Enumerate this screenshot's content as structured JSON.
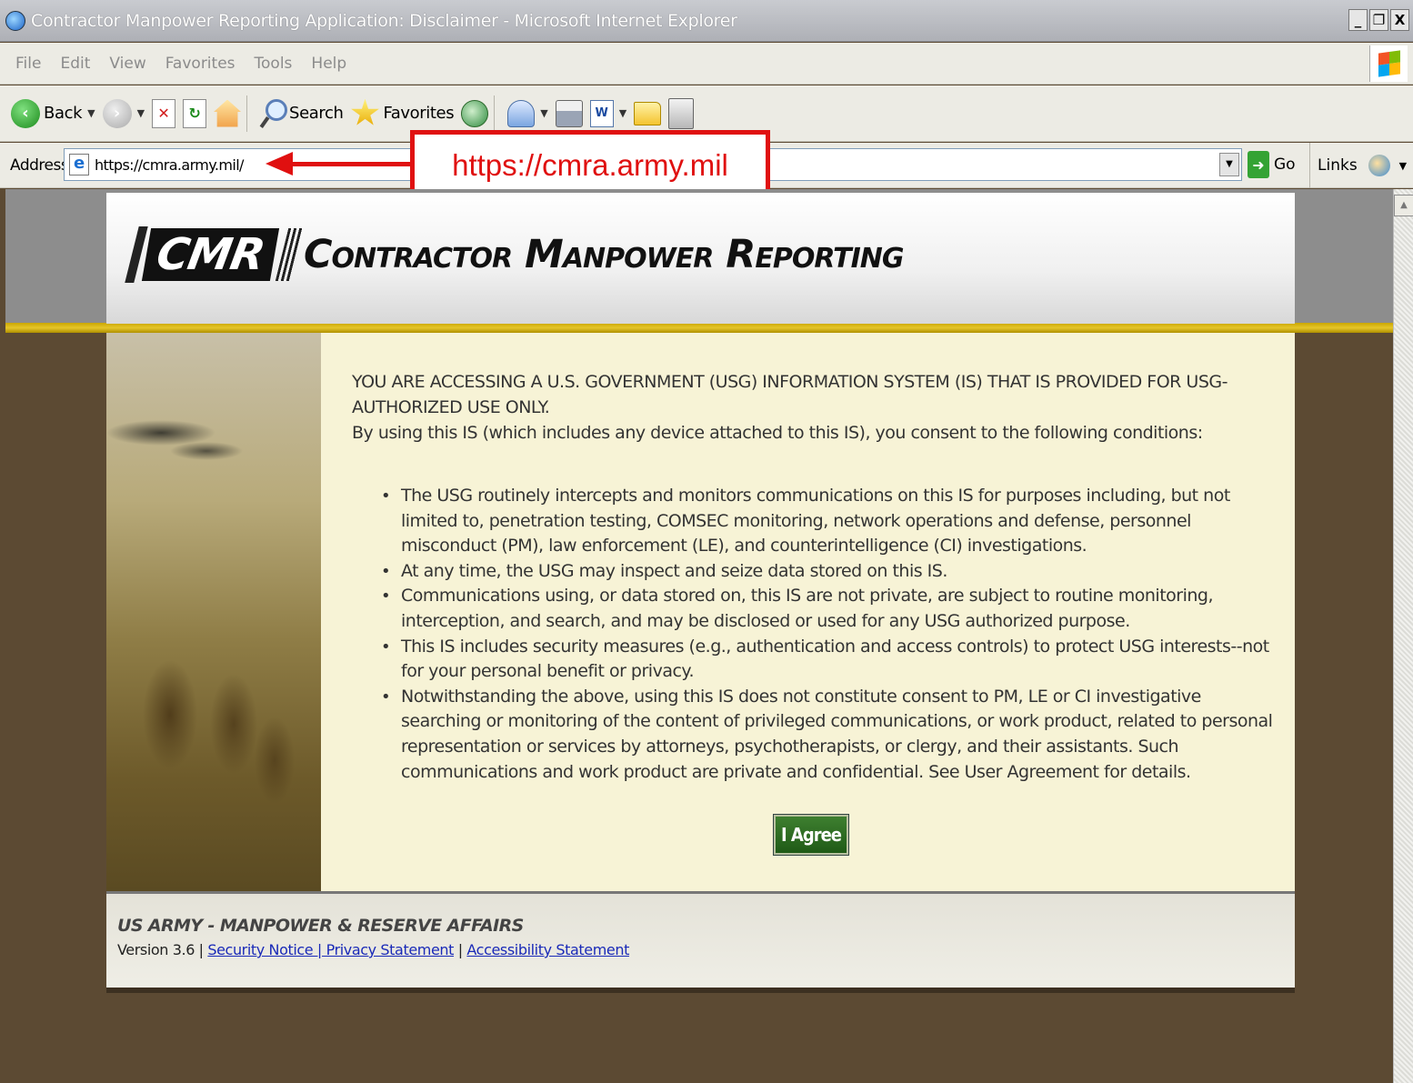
{
  "window": {
    "title": "Contractor Manpower Reporting Application: Disclaimer - Microsoft Internet Explorer",
    "controls": [
      "_",
      "❐",
      "X"
    ]
  },
  "menu": [
    "File",
    "Edit",
    "View",
    "Favorites",
    "Tools",
    "Help"
  ],
  "toolbar": {
    "back_label": "Back",
    "search_label": "Search",
    "favorites_label": "Favorites"
  },
  "address": {
    "label": "Address",
    "url": "https://cmra.army.mil/",
    "go_label": "Go",
    "links_label": "Links"
  },
  "callout": {
    "text": "https://cmra.army.mil"
  },
  "site": {
    "logo_abbr": "CMR",
    "logo_title": "Contractor Manpower Reporting"
  },
  "disclaimer": {
    "intro_line1": "YOU ARE ACCESSING A U.S. GOVERNMENT (USG) INFORMATION SYSTEM (IS) THAT IS PROVIDED FOR USG-AUTHORIZED USE ONLY.",
    "intro_line2": "By using this IS (which includes any device attached to this IS), you consent to the following conditions:",
    "conditions": [
      "The USG routinely intercepts and monitors communications on this IS for purposes including, but not limited to, penetration testing, COMSEC monitoring, network operations and defense, personnel misconduct (PM), law enforcement (LE), and counterintelligence (CI) investigations.",
      "At any time, the USG may inspect and seize data stored on this IS.",
      "Communications using, or data stored on, this IS are not private, are subject to routine monitoring, interception, and search, and may be disclosed or used for any USG authorized purpose.",
      "This IS includes security measures (e.g., authentication and access controls) to protect USG interests--not for your personal benefit or privacy.",
      "Notwithstanding the above, using this IS does not constitute consent to PM, LE or CI investigative searching or monitoring of the content of privileged communications, or work product, related to personal representation or services by attorneys, psychotherapists, or clergy, and their assistants. Such communications and work product are private and confidential. See User Agreement for details."
    ],
    "agree_label": "I Agree"
  },
  "footer": {
    "org": "US ARMY - MANPOWER & RESERVE AFFAIRS",
    "version": "Version 3.6",
    "security_privacy": "Security Notice | Privacy Statement",
    "accessibility": "Accessibility Statement"
  }
}
